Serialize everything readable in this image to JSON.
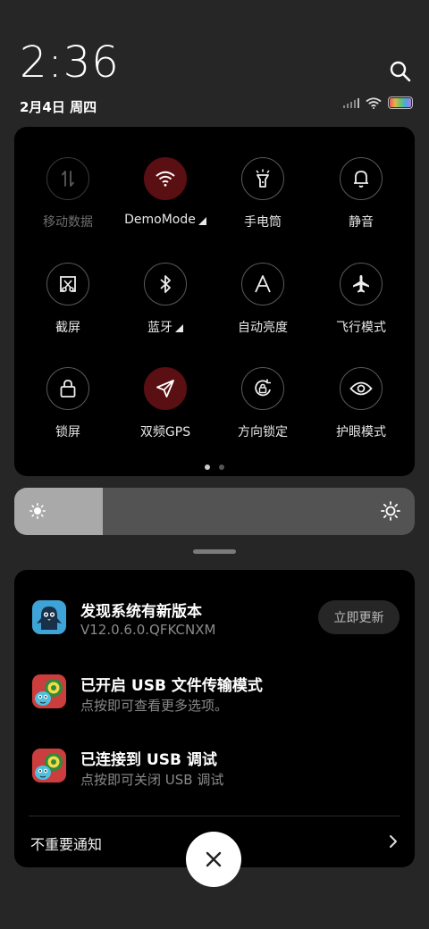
{
  "status": {
    "time": "2:36",
    "date": "2月4日 周四",
    "icons": [
      "signal-icon",
      "wifi-icon",
      "battery-icon"
    ]
  },
  "quick_settings": {
    "tiles": [
      {
        "label": "移动数据",
        "icon": "mobile-data-icon",
        "state": "disabled"
      },
      {
        "label": "DemoMode",
        "icon": "wifi-icon",
        "state": "on",
        "expand": true
      },
      {
        "label": "手电筒",
        "icon": "flashlight-icon",
        "state": "off"
      },
      {
        "label": "静音",
        "icon": "bell-icon",
        "state": "off"
      },
      {
        "label": "截屏",
        "icon": "screenshot-icon",
        "state": "off"
      },
      {
        "label": "蓝牙",
        "icon": "bluetooth-icon",
        "state": "off",
        "expand": true
      },
      {
        "label": "自动亮度",
        "icon": "auto-brightness-icon",
        "state": "off"
      },
      {
        "label": "飞行模式",
        "icon": "airplane-icon",
        "state": "off"
      },
      {
        "label": "锁屏",
        "icon": "lock-icon",
        "state": "off"
      },
      {
        "label": "双频GPS",
        "icon": "gps-icon",
        "state": "on"
      },
      {
        "label": "方向锁定",
        "icon": "rotation-lock-icon",
        "state": "off"
      },
      {
        "label": "护眼模式",
        "icon": "eye-icon",
        "state": "off"
      }
    ],
    "page_count": 2,
    "current_page": 1
  },
  "brightness": {
    "level_percent": 22
  },
  "notifications": [
    {
      "title": "发现系统有新版本",
      "text": "V12.0.6.0.QFKCNXM",
      "action": "立即更新",
      "icon": "updater-app-icon"
    },
    {
      "title": "已开启 USB 文件传输模式",
      "text": "点按即可查看更多选项。",
      "icon": "android-system-icon"
    },
    {
      "title": "已连接到 USB 调试",
      "text": "点按即可关闭 USB 调试",
      "icon": "android-system-icon"
    }
  ],
  "unimportant_label": "不重要通知",
  "colors": {
    "accent_on": "#5a0f12",
    "panel": "#000000",
    "background": "#262626"
  }
}
